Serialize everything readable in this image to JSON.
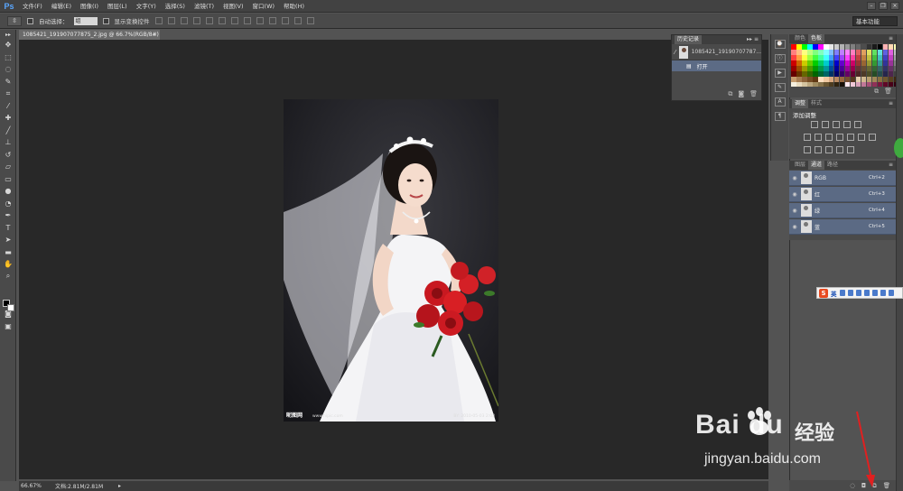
{
  "app": {
    "logo": "Ps"
  },
  "menu": [
    "文件(F)",
    "编辑(E)",
    "图像(I)",
    "图层(L)",
    "文字(Y)",
    "选择(S)",
    "滤镜(T)",
    "视图(V)",
    "窗口(W)",
    "帮助(H)"
  ],
  "options": {
    "auto_select_label": "自动选择：",
    "auto_select_value": "组",
    "show_transform_label": "显示变换控件",
    "workspace": "基本功能"
  },
  "document": {
    "tab_title": "1085421_191907077875_2.jpg @ 66.7%(RGB/8#)",
    "close_glyph": "×",
    "watermark_left": "昵图网",
    "watermark_mid": "www.nipic.com",
    "watermark_right": "BY: 2010-05-03 2:03"
  },
  "status": {
    "zoom": "66.67%",
    "doc_size": "文档:2.81M/2.81M",
    "arrow": "▸"
  },
  "history": {
    "tab": "历史记录",
    "controls": "▸▸ ≡",
    "snapshot": "1085421_19190707787...",
    "step": "打开"
  },
  "swatches": {
    "tab_inactive": "颜色",
    "tab_active": "色板"
  },
  "adjustments": {
    "tab_active": "调整",
    "tab_inactive": "样式",
    "title": "添加调整"
  },
  "channels": {
    "tabs": [
      "图层",
      "通道",
      "路径"
    ],
    "rows": [
      {
        "name": "RGB",
        "shortcut": "Ctrl+2"
      },
      {
        "name": "红",
        "shortcut": "Ctrl+3"
      },
      {
        "name": "绿",
        "shortcut": "Ctrl+4"
      },
      {
        "name": "蓝",
        "shortcut": "Ctrl+5"
      }
    ]
  },
  "ime": {
    "logo": "S",
    "lang": "英"
  },
  "watermark": {
    "brand": "Bai  du",
    "cn": "经验",
    "url": "jingyan.baidu.com"
  },
  "colors": {
    "canvas_bg": "#282828",
    "selected_row": "#5b6a84",
    "arrow": "#e02020"
  },
  "icons": {
    "toolbar": [
      "move-icon",
      "marquee-icon",
      "lasso-icon",
      "quick-select-icon",
      "crop-icon",
      "eyedropper-icon",
      "healing-icon",
      "brush-icon",
      "stamp-icon",
      "history-brush-icon",
      "eraser-icon",
      "gradient-icon",
      "blur-icon",
      "dodge-icon",
      "pen-icon",
      "type-icon",
      "path-select-icon",
      "shape-icon",
      "hand-icon",
      "zoom-icon"
    ]
  }
}
